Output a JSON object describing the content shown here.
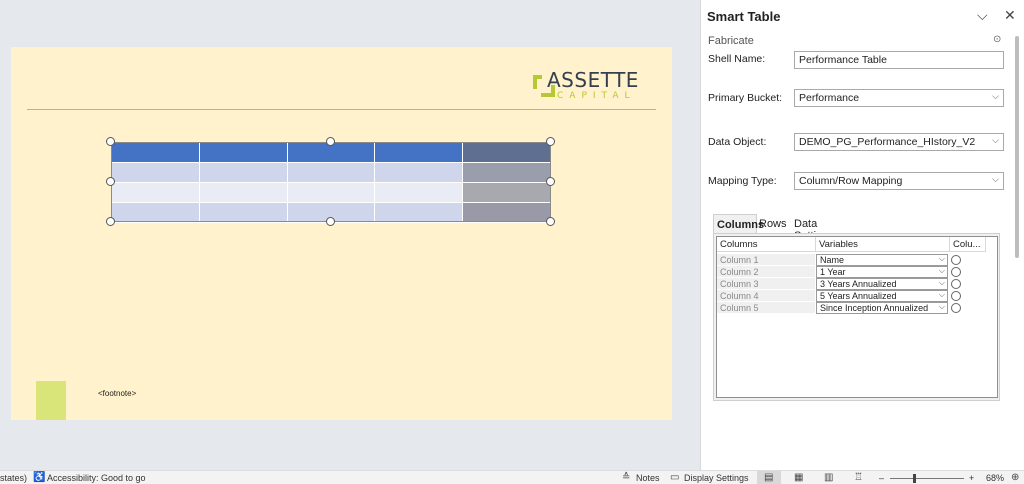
{
  "slide": {
    "logo": {
      "title": "ASSETTE",
      "subtitle": "CAPITAL"
    },
    "footnote": "<footnote>"
  },
  "pane": {
    "title": "Smart Table",
    "controls": {
      "collapse": "⌵",
      "close": "✕"
    },
    "section": "Fabricate",
    "fields": {
      "shell_name": {
        "label": "Shell Name:",
        "value": "Performance Table"
      },
      "primary_bucket": {
        "label": "Primary Bucket:",
        "value": "Performance"
      },
      "data_object": {
        "label": "Data Object:",
        "value": "DEMO_PG_Performance_HIstory_V2"
      },
      "mapping_type": {
        "label": "Mapping Type:",
        "value": "Column/Row Mapping"
      }
    },
    "tabs": [
      "Columns",
      "Rows",
      "Data Settings"
    ],
    "grid": {
      "headers": [
        "Columns",
        "Variables",
        "Colu..."
      ],
      "rows": [
        {
          "name": "Column 1",
          "variable": "Name"
        },
        {
          "name": "Column 2",
          "variable": "1 Year"
        },
        {
          "name": "Column 3",
          "variable": "3 Years Annualized"
        },
        {
          "name": "Column 4",
          "variable": "5 Years Annualized"
        },
        {
          "name": "Column 5",
          "variable": "Since Inception Annualized"
        }
      ]
    }
  },
  "status": {
    "left_text": "states)",
    "accessibility": "Accessibility: Good to go",
    "notes": "Notes",
    "display_settings": "Display Settings",
    "zoom": "68%"
  },
  "colors": {
    "accent_green": "#b6c934",
    "table_header": "#4472c4",
    "slide_bg": "#fff2cc"
  }
}
